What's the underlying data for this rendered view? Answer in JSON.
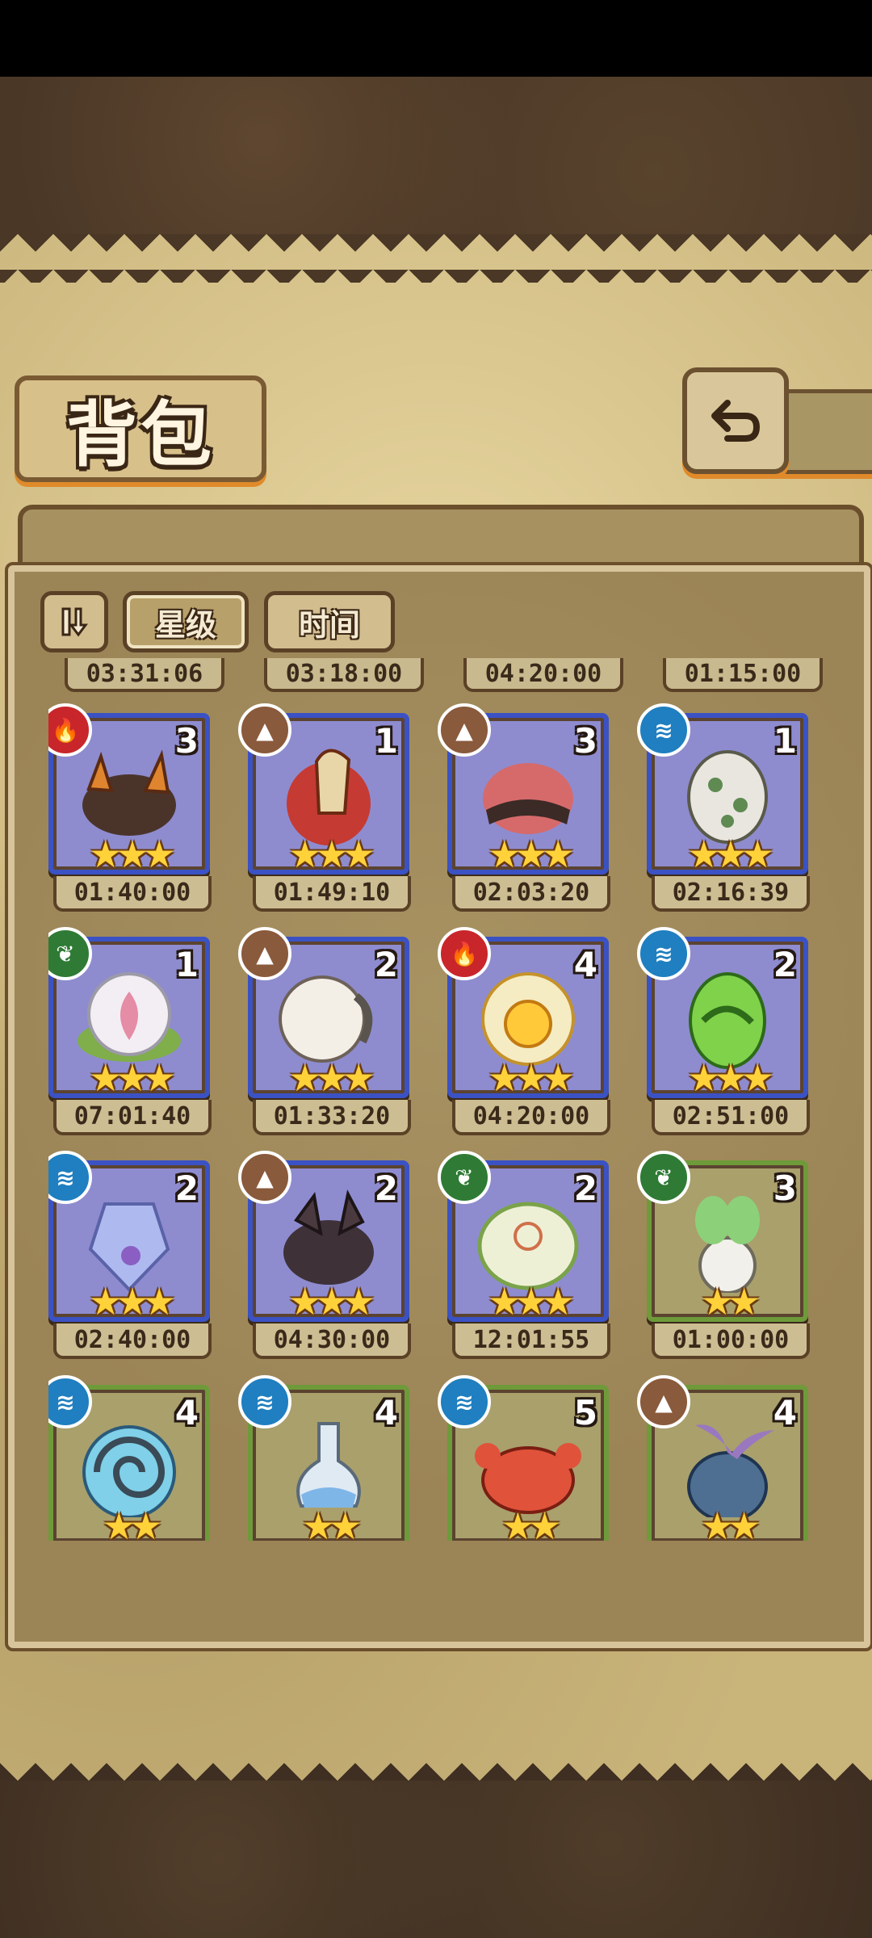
{
  "title": "背包",
  "sort": {
    "toggle_label": "",
    "star_label": "星级",
    "time_label": "时间"
  },
  "prev_timers": [
    "03:31:06",
    "03:18:00",
    "04:20:00",
    "01:15:00"
  ],
  "colors": {
    "fire": "#c8262b",
    "earth": "#8a5a3c",
    "water": "#1f7fc0",
    "grass": "#2f7b35",
    "star": "#ffd23a"
  },
  "cards": [
    {
      "element": "fire",
      "element_icon": "flame-icon",
      "count": "3",
      "stars": 3,
      "timer": "01:40:00",
      "frame": "blue",
      "egg": "spiky-dark-egg"
    },
    {
      "element": "earth",
      "element_icon": "mountain-icon",
      "count": "1",
      "stars": 3,
      "timer": "01:49:10",
      "frame": "blue",
      "egg": "red-helmet-egg"
    },
    {
      "element": "earth",
      "element_icon": "mountain-icon",
      "count": "3",
      "stars": 3,
      "timer": "02:03:20",
      "frame": "blue",
      "egg": "pink-cat-egg"
    },
    {
      "element": "water",
      "element_icon": "wave-icon",
      "count": "1",
      "stars": 3,
      "timer": "02:16:39",
      "frame": "blue",
      "egg": "stone-egg"
    },
    {
      "element": "grass",
      "element_icon": "leaf-icon",
      "count": "1",
      "stars": 3,
      "timer": "07:01:40",
      "frame": "blue",
      "egg": "lotus-egg"
    },
    {
      "element": "earth",
      "element_icon": "mountain-icon",
      "count": "2",
      "stars": 3,
      "timer": "01:33:20",
      "frame": "blue",
      "egg": "fluffy-horn-egg"
    },
    {
      "element": "fire",
      "element_icon": "flame-icon",
      "count": "4",
      "stars": 3,
      "timer": "04:20:00",
      "frame": "blue",
      "egg": "sun-egg"
    },
    {
      "element": "water",
      "element_icon": "wave-icon",
      "count": "2",
      "stars": 3,
      "timer": "02:51:00",
      "frame": "blue",
      "egg": "green-slime-egg"
    },
    {
      "element": "water",
      "element_icon": "wave-icon",
      "count": "2",
      "stars": 3,
      "timer": "02:40:00",
      "frame": "blue",
      "egg": "crystal-egg"
    },
    {
      "element": "earth",
      "element_icon": "mountain-icon",
      "count": "2",
      "stars": 3,
      "timer": "04:30:00",
      "frame": "blue",
      "egg": "dark-wing-egg"
    },
    {
      "element": "grass",
      "element_icon": "leaf-icon",
      "count": "2",
      "stars": 3,
      "timer": "12:01:55",
      "frame": "blue",
      "egg": "leaf-pod-egg"
    },
    {
      "element": "grass",
      "element_icon": "leaf-icon",
      "count": "3",
      "stars": 2,
      "timer": "01:00:00",
      "frame": "green",
      "egg": "turnip-egg"
    },
    {
      "element": "water",
      "element_icon": "wave-icon",
      "count": "4",
      "stars": 2,
      "timer": "",
      "frame": "green",
      "egg": "shell-egg"
    },
    {
      "element": "water",
      "element_icon": "wave-icon",
      "count": "4",
      "stars": 2,
      "timer": "",
      "frame": "green",
      "egg": "flask-egg"
    },
    {
      "element": "water",
      "element_icon": "wave-icon",
      "count": "5",
      "stars": 2,
      "timer": "",
      "frame": "green",
      "egg": "crab-egg"
    },
    {
      "element": "earth",
      "element_icon": "mountain-icon",
      "count": "4",
      "stars": 2,
      "timer": "",
      "frame": "green",
      "egg": "whale-tail-egg"
    }
  ]
}
